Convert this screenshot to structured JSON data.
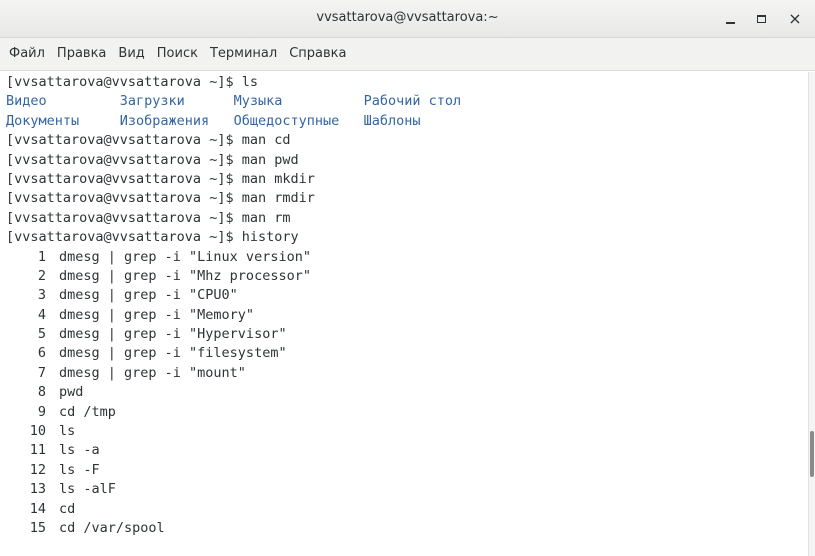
{
  "window": {
    "title": "vvsattarova@vvsattarova:~",
    "controls": {
      "minimize": "minimize-icon",
      "maximize": "maximize-icon",
      "close": "×"
    }
  },
  "menubar": [
    "Файл",
    "Правка",
    "Вид",
    "Поиск",
    "Терминал",
    "Справка"
  ],
  "terminal": {
    "prompt": "[vvsattarova@vvsattarova ~]$ ",
    "commands_before_listing": [
      "ls"
    ],
    "dir_listing": [
      [
        "Видео",
        "Загрузки",
        "Музыка",
        "Рабочий стол"
      ],
      [
        "Документы",
        "Изображения",
        "Общедоступные",
        "Шаблоны"
      ]
    ],
    "commands_after_listing": [
      "man cd",
      "man pwd",
      "man mkdir",
      "man rmdir",
      "man rm",
      "history"
    ],
    "history": [
      {
        "n": "1",
        "cmd": "dmesg | grep -i \"Linux version\""
      },
      {
        "n": "2",
        "cmd": "dmesg | grep -i \"Mhz processor\""
      },
      {
        "n": "3",
        "cmd": "dmesg | grep -i \"CPU0\""
      },
      {
        "n": "4",
        "cmd": "dmesg | grep -i \"Memory\""
      },
      {
        "n": "5",
        "cmd": "dmesg | grep -i \"Hypervisor\""
      },
      {
        "n": "6",
        "cmd": "dmesg | grep -i \"filesystem\""
      },
      {
        "n": "7",
        "cmd": "dmesg | grep -i \"mount\""
      },
      {
        "n": "8",
        "cmd": "pwd"
      },
      {
        "n": "9",
        "cmd": "cd /tmp"
      },
      {
        "n": "10",
        "cmd": "ls"
      },
      {
        "n": "11",
        "cmd": "ls -a"
      },
      {
        "n": "12",
        "cmd": "ls -F"
      },
      {
        "n": "13",
        "cmd": "ls -alF"
      },
      {
        "n": "14",
        "cmd": "cd"
      },
      {
        "n": "15",
        "cmd": "cd /var/spool"
      }
    ],
    "colors": {
      "text": "#2e3436",
      "directory": "#3465a4",
      "background": "#ffffff"
    }
  },
  "scrollbar": {
    "position_fraction": 0.82
  }
}
